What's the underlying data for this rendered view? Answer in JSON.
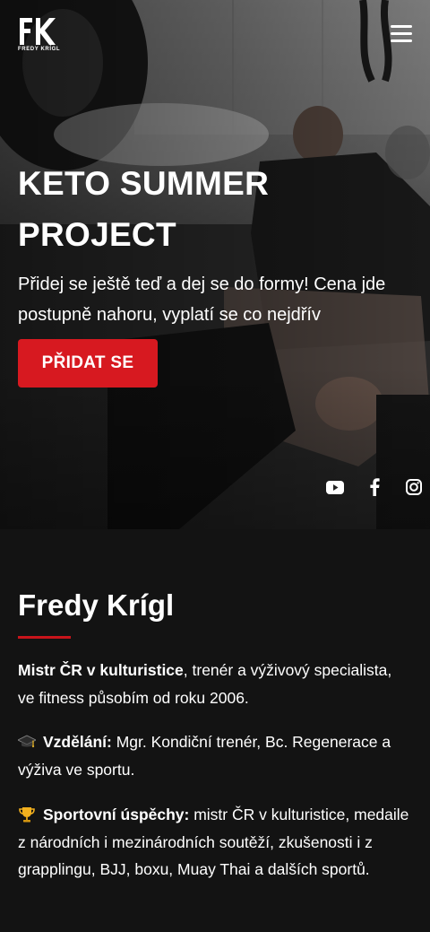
{
  "header": {
    "logo_text": "FK",
    "logo_subtitle": "FREDY KRÍGL",
    "menu_icon": "hamburger-menu-icon"
  },
  "hero": {
    "title": "KETO SUMMER PROJECT",
    "text": "Přidej se ještě teď a dej se do formy! Cena jde postupně nahoru, vyplatí se co nejdřív",
    "cta_label": "PŘIDAT SE",
    "cta_color": "#d71920",
    "socials": [
      "youtube-icon",
      "facebook-icon",
      "instagram-icon"
    ]
  },
  "about": {
    "title": "Fredy Krígl",
    "accent_color": "#c8141b",
    "items": [
      {
        "bold": "Mistr ČR v kulturistice",
        "text": ", trenér a výživový specialista, ve fitness působím od roku 2006."
      },
      {
        "icon": "graduation-cap-icon",
        "bold": "Vzdělání:",
        "text": " Mgr. Kondiční trenér, Bc. Regenerace a výživa ve sportu."
      },
      {
        "icon": "trophy-icon",
        "bold": "Sportovní úspěchy:",
        "text": " mistr ČR v kulturistice, medaile z národních i mezinárodních soutěží, zkušenosti i z grapplingu, BJJ, boxu, Muay Thai a dalších sportů."
      }
    ]
  }
}
